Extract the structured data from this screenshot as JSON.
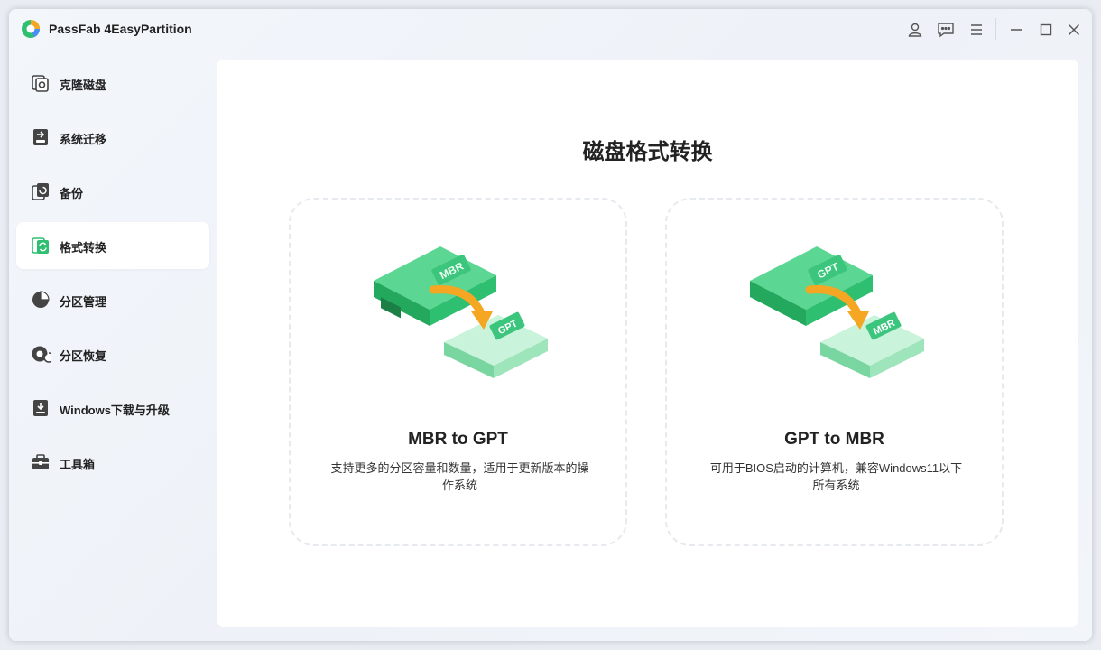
{
  "app": {
    "title": "PassFab 4EasyPartition"
  },
  "titlebar": {
    "icons": [
      "user-icon",
      "feedback-icon",
      "menu-icon",
      "minimize-icon",
      "maximize-icon",
      "close-icon"
    ]
  },
  "sidebar": {
    "items": [
      {
        "label": "克隆磁盘",
        "icon": "clone-disk-icon",
        "active": false
      },
      {
        "label": "系统迁移",
        "icon": "system-migration-icon",
        "active": false
      },
      {
        "label": "备份",
        "icon": "backup-icon",
        "active": false
      },
      {
        "label": "格式转换",
        "icon": "format-convert-icon",
        "active": true
      },
      {
        "label": "分区管理",
        "icon": "partition-manage-icon",
        "active": false
      },
      {
        "label": "分区恢复",
        "icon": "partition-recovery-icon",
        "active": false
      },
      {
        "label": "Windows下载与升级",
        "icon": "windows-download-icon",
        "active": false
      },
      {
        "label": "工具箱",
        "icon": "toolbox-icon",
        "active": false
      }
    ]
  },
  "main": {
    "title": "磁盘格式转换",
    "cards": [
      {
        "title": "MBR to GPT",
        "desc_line1": "支持更多的分区容量和数量，适用于更新版本的操",
        "desc_line2": "作系统",
        "source_label": "MBR",
        "target_label": "GPT"
      },
      {
        "title": "GPT to MBR",
        "desc_line1": "可用于BIOS启动的计算机，兼容Windows11以下",
        "desc_line2": "所有系统",
        "source_label": "GPT",
        "target_label": "MBR"
      }
    ]
  },
  "colors": {
    "accent": "#2fbf71",
    "accent_light": "#8fe0b1",
    "arrow": "#f5a623",
    "text": "#222222"
  }
}
